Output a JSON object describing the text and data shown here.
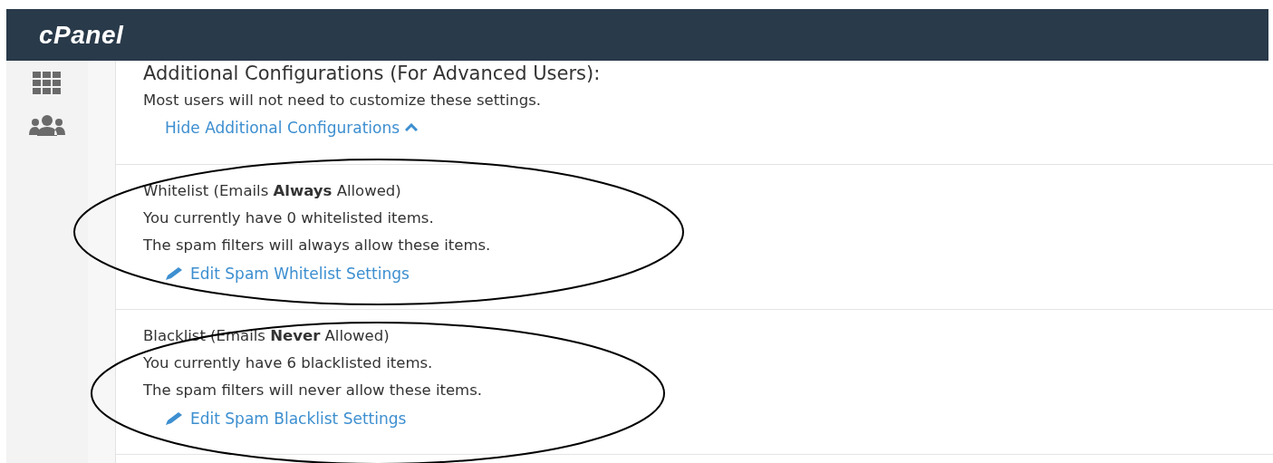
{
  "header": {
    "logo": "cPanel"
  },
  "sidebar": {
    "items": [
      {
        "kind": "grid",
        "selected": false
      },
      {
        "kind": "users",
        "selected": false
      }
    ]
  },
  "intro": {
    "title": "Additional Configurations (For Advanced Users):",
    "description": "Most users will not need to customize these settings.",
    "toggle_link": "Hide Additional Configurations",
    "expanded": true
  },
  "sections": [
    {
      "heading": "Whitelist (Emails **Always** Allowed)",
      "count_text": "You currently have 0 whitelisted items.",
      "note": "The spam filters will always allow these items.",
      "link": "Edit Spam Whitelist Settings"
    },
    {
      "heading": "Blacklist (Emails **Never** Allowed)",
      "count_text": "You currently have 6 blacklisted items.",
      "note": "The spam filters will never allow these items.",
      "link": "Edit Spam Blacklist Settings"
    }
  ],
  "annotations": [
    {
      "kind": "ellipse"
    },
    {
      "kind": "ellipse"
    }
  ]
}
